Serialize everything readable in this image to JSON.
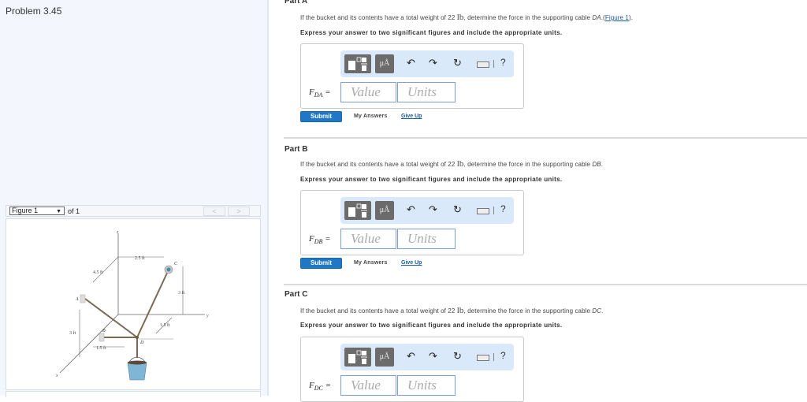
{
  "problem": {
    "title": "Problem 3.45"
  },
  "figure": {
    "selector_value": "Figure 1",
    "of_label": "of 1",
    "prev_label": "<",
    "next_label": ">",
    "labels": {
      "z": "z",
      "y": "y",
      "x": "x",
      "A": "A",
      "B": "B",
      "C": "C",
      "D": "D",
      "dim_2_5": "2.5 ft",
      "dim_4_5": "4.5 ft",
      "dim_3_right": "3 ft",
      "dim_3_left": "3 ft",
      "dim_1_5_right": "1.5 ft",
      "dim_1_5_bottom": "1.5 ft"
    }
  },
  "common": {
    "q_prefix": "If the bucket and its contents have a total weight of 22 ",
    "q_unit": "lb",
    "q_mid": ", determine the force in the supporting cable ",
    "express": "Express your answer to two significant figures and include the appropriate units.",
    "value_placeholder": "Value",
    "units_placeholder": "Units",
    "units_btn": "μÅ",
    "submit": "Submit",
    "my_answers": "My Answers",
    "give_up": "Give Up",
    "help": "?"
  },
  "parts": [
    {
      "title": "Part A",
      "cable": "DA",
      "suffix": ".(",
      "figure_link": "Figure 1",
      "suffix_end": ").",
      "var": "F",
      "sub": "DA",
      "eq": " ="
    },
    {
      "title": "Part B",
      "cable": "DB",
      "suffix": ".",
      "var": "F",
      "sub": "DB",
      "eq": " ="
    },
    {
      "title": "Part C",
      "cable": "DC",
      "suffix": ".",
      "var": "F",
      "sub": "DC",
      "eq": " ="
    }
  ]
}
